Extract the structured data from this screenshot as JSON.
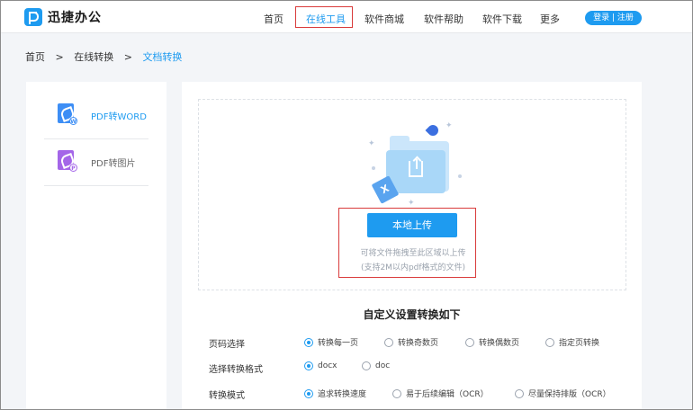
{
  "header": {
    "logo_text": "迅捷办公",
    "nav": [
      "首页",
      "在线工具",
      "软件商城",
      "软件帮助",
      "软件下载",
      "更多"
    ],
    "active_nav": "在线工具",
    "login_label": "登录 | 注册"
  },
  "breadcrumb": {
    "home": "首页",
    "sep1": ">",
    "level2": "在线转换",
    "sep2": ">",
    "current": "文档转换"
  },
  "sidebar": {
    "items": [
      {
        "label": "PDF转WORD",
        "icon": "pdf-to-word-icon",
        "badge": "W",
        "active": true
      },
      {
        "label": "PDF转图片",
        "icon": "pdf-to-image-icon",
        "badge": "P",
        "active": false
      }
    ]
  },
  "upload": {
    "file_badge": "X",
    "button_label": "本地上传",
    "hint_line1": "可将文件拖拽至此区域以上传",
    "hint_line2": "(支持2M以内pdf格式的文件)"
  },
  "settings": {
    "title": "自定义设置转换如下",
    "rows": [
      {
        "label": "页码选择",
        "options": [
          "转换每一页",
          "转换奇数页",
          "转换偶数页",
          "指定页转换"
        ],
        "selected": 0
      },
      {
        "label": "选择转换格式",
        "options": [
          "docx",
          "doc"
        ],
        "selected": 0
      },
      {
        "label": "转换模式",
        "options": [
          "追求转换速度",
          "易于后续编辑（OCR）",
          "尽量保持排版（OCR）"
        ],
        "selected": 0
      }
    ]
  },
  "colors": {
    "accent": "#1e9bf0",
    "highlight_box": "#d93b3b",
    "page_bg": "#f3f5f8"
  }
}
